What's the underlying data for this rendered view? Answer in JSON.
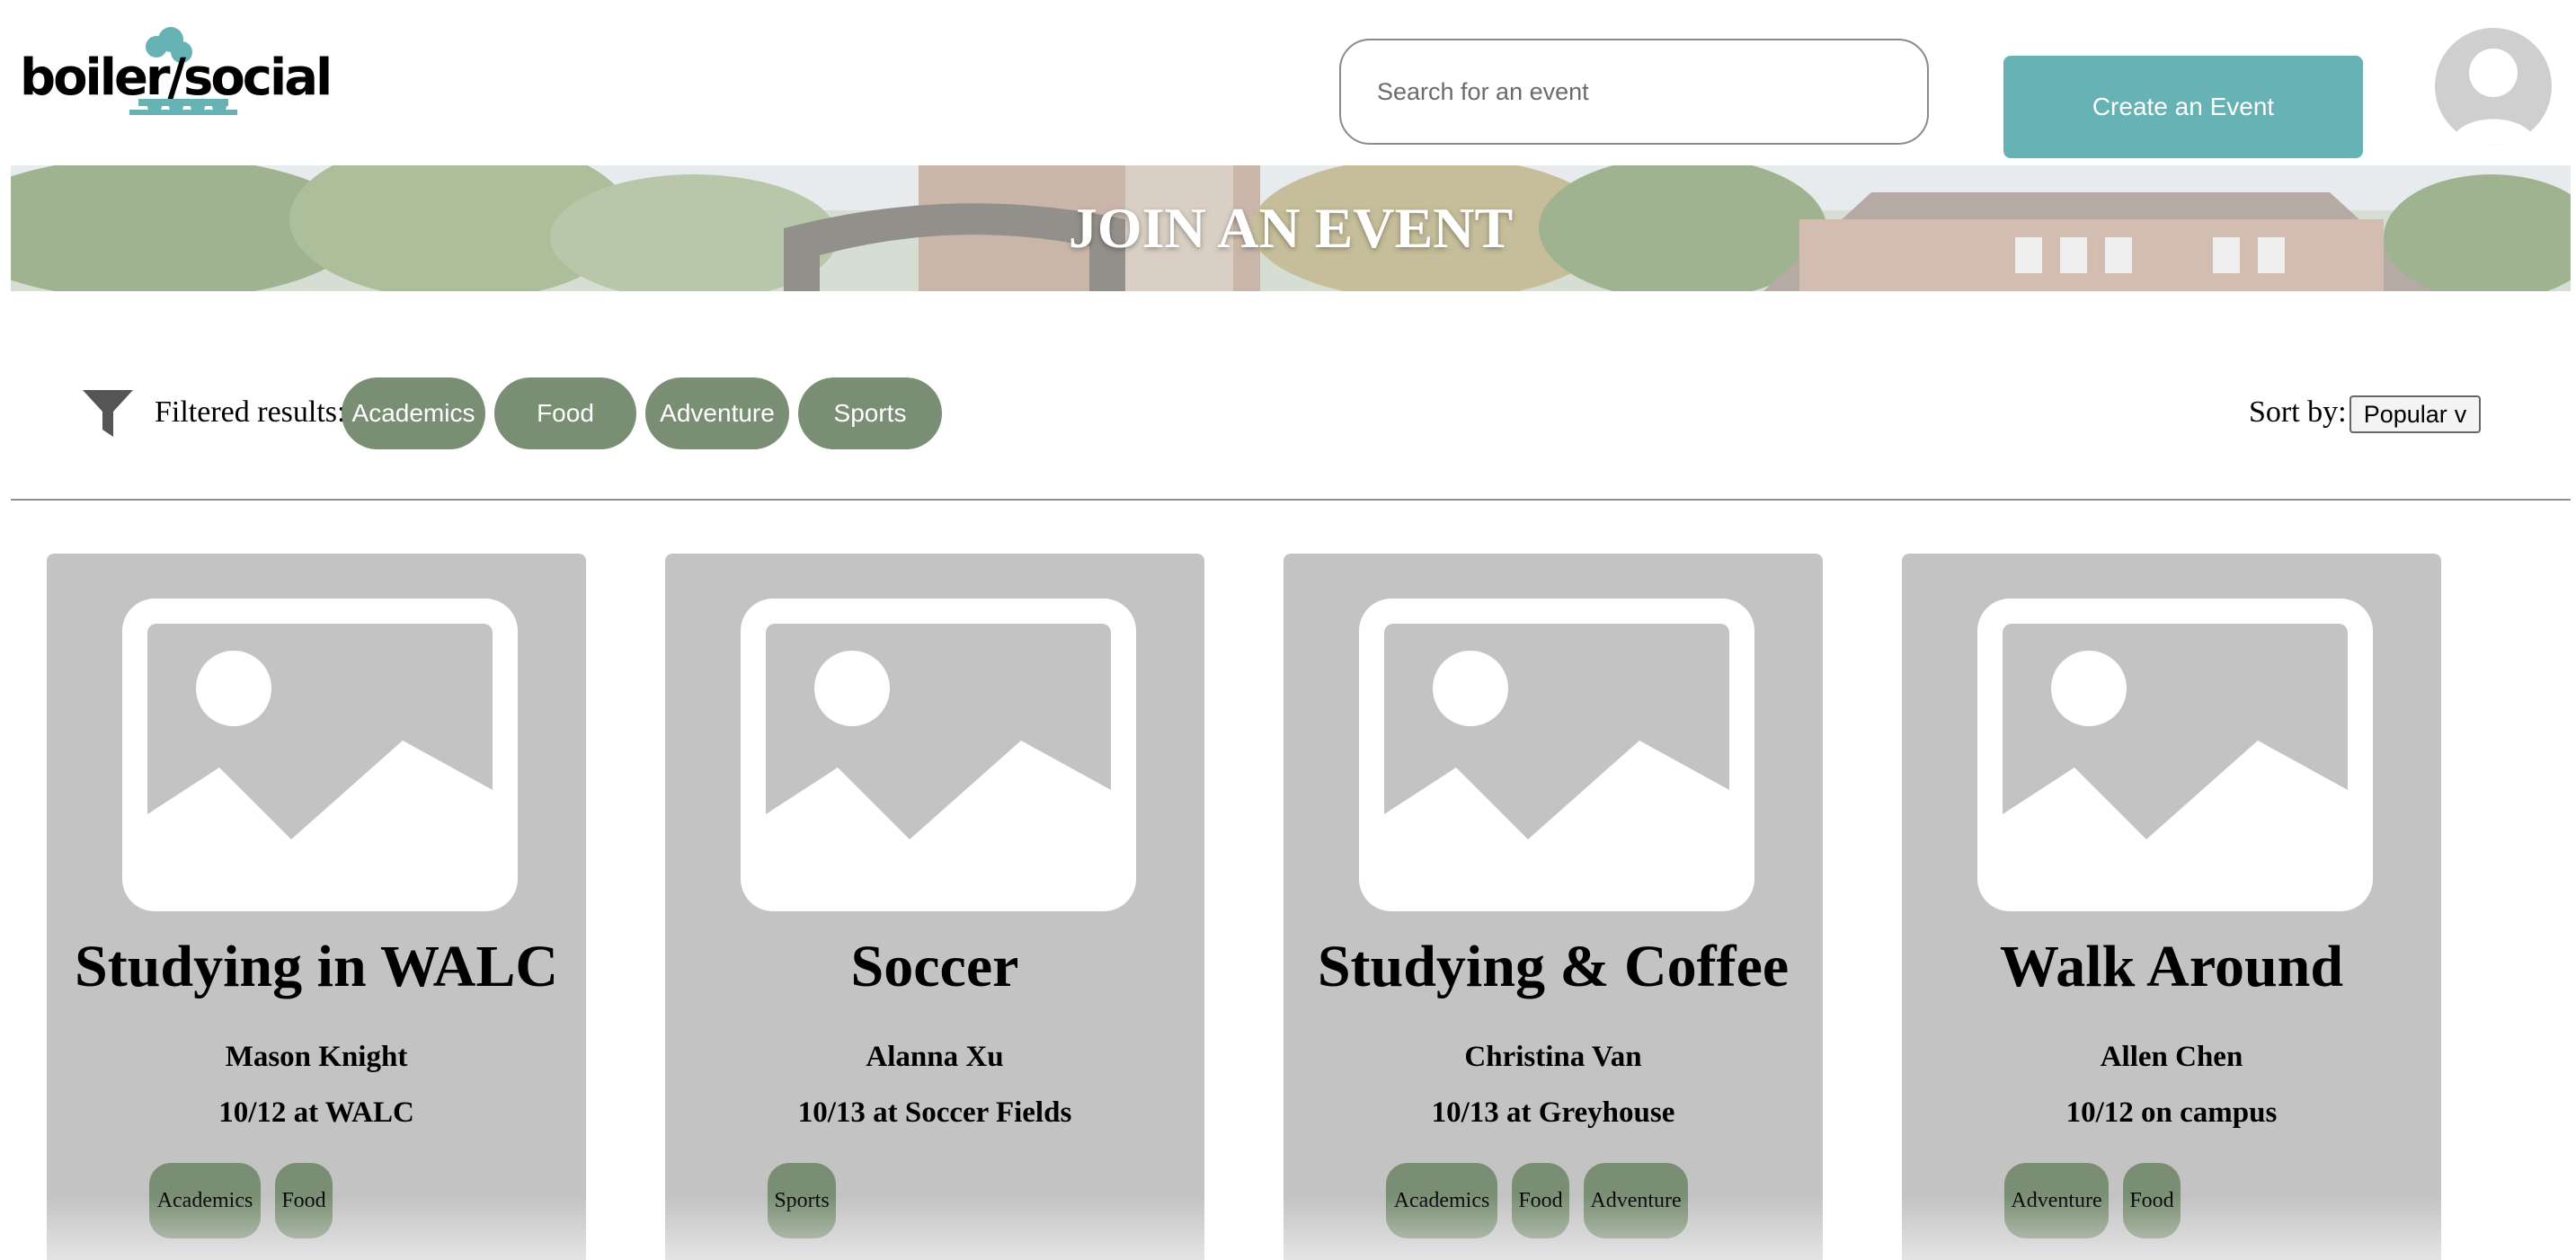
{
  "header": {
    "logo_text": "boiler/social",
    "search": {
      "placeholder": "Search for an event",
      "value": ""
    },
    "create_button_label": "Create an Event",
    "avatar_icon": "user-avatar-icon"
  },
  "banner": {
    "title": "JOIN AN EVENT"
  },
  "filters": {
    "label": "Filtered results:",
    "icon": "filter-icon",
    "chips": [
      {
        "label": "Academics"
      },
      {
        "label": "Food"
      },
      {
        "label": "Adventure"
      },
      {
        "label": "Sports"
      }
    ]
  },
  "sort": {
    "label": "Sort by:",
    "selected": "Popular",
    "caret": "v"
  },
  "events": [
    {
      "title": "Studying in WALC",
      "host": "Mason Knight",
      "when": "10/12 at WALC",
      "tags": [
        "Academics",
        "Food"
      ]
    },
    {
      "title": "Soccer",
      "host": "Alanna Xu",
      "when": "10/13 at Soccer Fields",
      "tags": [
        "Sports"
      ]
    },
    {
      "title": "Studying & Coffee",
      "host": "Christina Van",
      "when": "10/13 at Greyhouse",
      "tags": [
        "Academics",
        "Food",
        "Adventure"
      ]
    },
    {
      "title": "Walk Around",
      "host": "Allen Chen",
      "when": "10/12 on campus",
      "tags": [
        "Adventure",
        "Food"
      ]
    }
  ],
  "colors": {
    "accent": "#66b2b5",
    "chip": "#7a8e74",
    "card": "#c3c3c3"
  }
}
